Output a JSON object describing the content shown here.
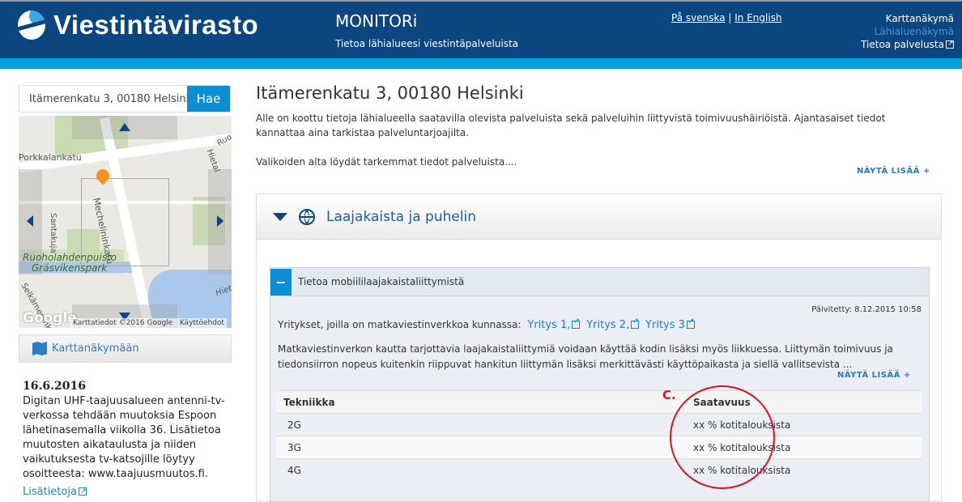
{
  "header": {
    "logo": "Viestintävirasto",
    "app_title": "MONITORi",
    "subtitle": "Tietoa lähialueesi viestintäpalveluista",
    "lang_sv": "På svenska",
    "lang_sep": "|",
    "lang_en": "In English",
    "nav": [
      "Karttanäkymä",
      "Lähialuenäkymä",
      "Tietoa palvelusta"
    ]
  },
  "search": {
    "value": "Itämerenkatu 3, 00180 Helsinki",
    "button": "Hae"
  },
  "map": {
    "labels": [
      "Porkkalankatu",
      "Mechelininkatu",
      "Santakuja",
      "Ruoholahdenpuisto",
      "Gräsvikenspark",
      "Selkämerenkatu",
      "Hietal",
      "Ruo",
      "Hieta"
    ],
    "google": "Google",
    "attribution": "Karttatiedot ©2016 Google",
    "terms": "Käyttöehdot"
  },
  "map_button": "Karttanäkymään",
  "news": {
    "date": "16.6.2016",
    "text": "Digitan UHF-taajuusalueen antenni-tv-verkossa tehdään muutoksia Espoon lähetinasemalla viikolla 36. Lisätietoa muutosten aikataulusta ja niiden vaikutuksesta tv-katsojille löytyy osoitteesta: www.taajuusmuutos.fi.",
    "link": "Lisätietoja"
  },
  "main": {
    "title": "Itämerenkatu 3, 00180 Helsinki",
    "intro1": "Alle on koottu tietoja lähialueella saatavilla olevista palveluista sekä palveluihin liittyvistä toimivuushäiriöistä. Ajantasaiset tiedot kannattaa aina tarkistaa palveluntarjoajilta.",
    "intro2": "Valikoiden alta löydät tarkemmat tiedot palveluista....",
    "more": "NÄYTÄ LISÄÄ +"
  },
  "panel": {
    "title": "Laajakaista ja puhelin",
    "sub": {
      "title": "Tietoa mobiililaajakaistaliittymistä",
      "updated": "Päivitetty: 8.12.2015 10:58",
      "companies_label": "Yritykset, joilla on matkaviestinverkkoa kunnassa:",
      "companies": [
        "Yritys 1,",
        "Yritys 2,",
        "Yritys 3"
      ],
      "desc": "Matkaviestinverkon kautta tarjottavia laajakaistaliittymiä voidaan käyttää kodin lisäksi myös liikkuessa. Liittymän toimivuus ja tiedonsiirron nopeus kuitenkin riippuvat hankitun liittymän lisäksi merkittävästi käyttöpaikasta ja siellä vallitsevista ...",
      "more": "NÄYTÄ LISÄÄ +",
      "table": {
        "headers": [
          "Tekniikka",
          "Saatavuus"
        ],
        "rows": [
          [
            "2G",
            "xx % kotitalouksista"
          ],
          [
            "3G",
            "xx % kotitalouksista"
          ],
          [
            "4G",
            "xx % kotitalouksista"
          ]
        ]
      }
    }
  },
  "annotation": {
    "label": "C.",
    "color": "#e01020"
  },
  "colors": {
    "header": "#0b4680",
    "accent": "#00a0df",
    "button": "#0a8fd4",
    "link": "#1a7fc8"
  }
}
